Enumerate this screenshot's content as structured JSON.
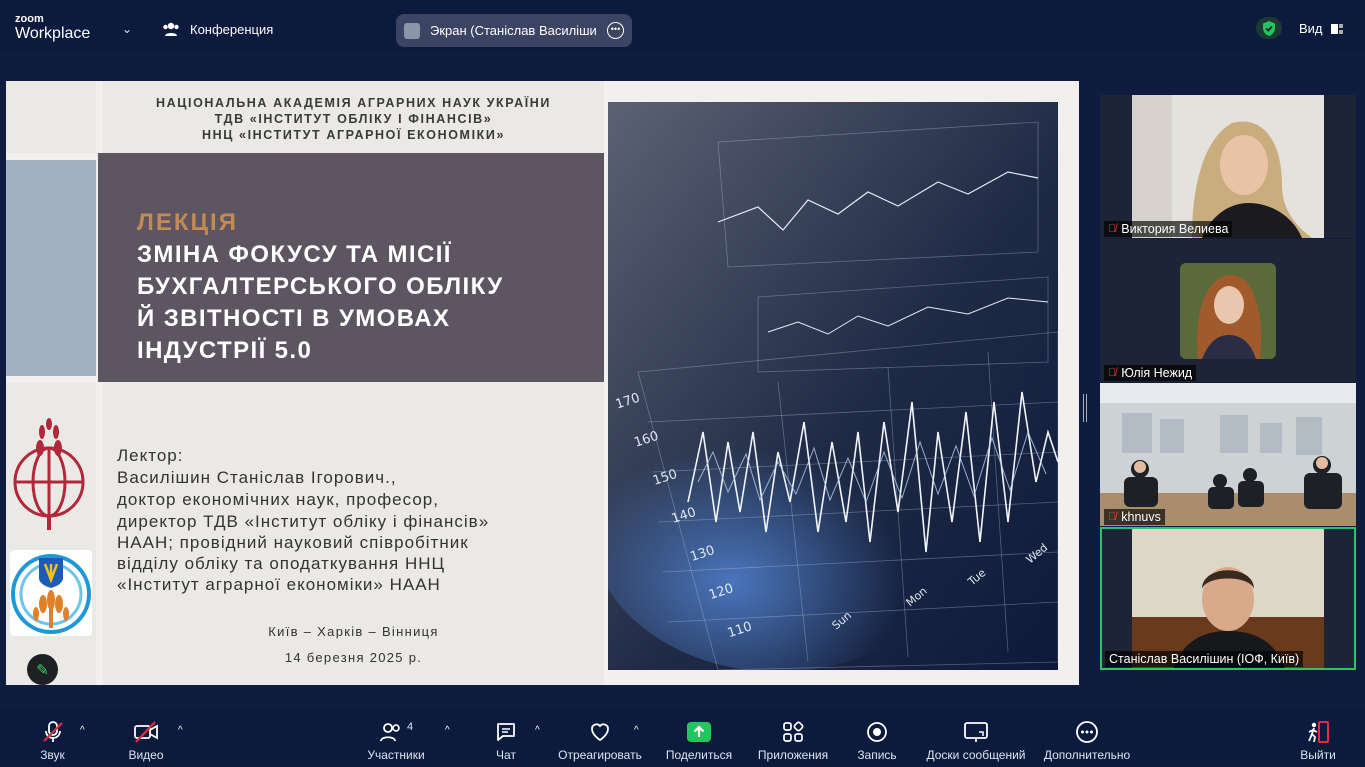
{
  "topbar": {
    "logo_small": "zoom",
    "logo_main": "Workplace",
    "conference_label": "Конференция",
    "screen_label": "Экран (Станіслав Василішин (ІО",
    "view_label": "Вид",
    "shield_color": "#22c55e"
  },
  "slide": {
    "header": [
      "НАЦІОНАЛЬНА АКАДЕМІЯ АГРАРНИХ НАУК УКРАЇНИ",
      "ТДВ «ІНСТИТУТ ОБЛІКУ І ФІНАНСІВ»",
      "ННЦ «ІНСТИТУТ АГРАРНОЇ ЕКОНОМІКИ»"
    ],
    "lecture_label": "ЛЕКЦІЯ",
    "title_lines": [
      "ЗМІНА ФОКУСУ ТА МІСІЇ",
      "БУХГАЛТЕРСЬКОГО ОБЛІКУ",
      "Й ЗВІТНОСТІ В УМОВАХ",
      "ІНДУСТРІЇ 5.0"
    ],
    "lecturer_label": "Лектор:",
    "lecturer_name": "Василішин Станіслав Ігорович.",
    "lecturer_name_suffix": ",",
    "lecturer_lines": [
      "доктор економічних наук, професор,",
      "директор ТДВ «Інститут обліку і фінансів»",
      "НААН; провідний науковий співробітник",
      "відділу обліку та оподаткування ННЦ",
      "«Інститут аграрної економіки» НААН"
    ],
    "cities": "Київ – Харків – Вінниця",
    "date": "14 березня 2025 р.",
    "chart_axis_labels": [
      "170",
      "160",
      "150",
      "140",
      "130",
      "120",
      "110"
    ],
    "chart_day_labels": [
      "Sun",
      "Mon",
      "Tue",
      "Wed"
    ]
  },
  "participants": [
    {
      "name": "Виктория Велиева",
      "muted": true
    },
    {
      "name": "Юлія Нежид",
      "muted": true
    },
    {
      "name": "khnuvs",
      "muted": true
    },
    {
      "name": "Станіслав Василішин (ІОФ, Київ)",
      "muted": false
    }
  ],
  "toolbar": {
    "audio": "Звук",
    "video": "Видео",
    "participants": "Участники",
    "participants_count": "4",
    "chat": "Чат",
    "react": "Отреагировать",
    "share": "Поделиться",
    "apps": "Приложения",
    "record": "Запись",
    "whiteboards": "Доски сообщений",
    "more": "Дополнительно",
    "leave": "Выйти",
    "share_color": "#22c55e",
    "leave_color": "#e02e3e"
  }
}
